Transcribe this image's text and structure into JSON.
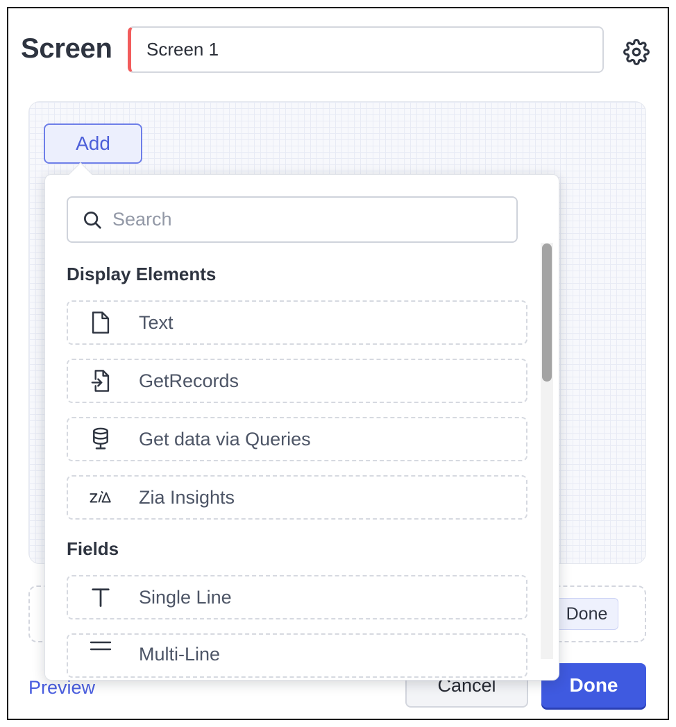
{
  "header": {
    "title": "Screen",
    "name_value": "Screen 1",
    "settings_icon": "gear-icon"
  },
  "canvas": {
    "add_label": "Add",
    "inner_done_label": "Done"
  },
  "popup": {
    "search_placeholder": "Search",
    "search_icon": "search-icon",
    "sections": [
      {
        "title": "Display Elements",
        "items": [
          {
            "label": "Text",
            "icon": "file-icon"
          },
          {
            "label": "GetRecords",
            "icon": "file-import-icon"
          },
          {
            "label": "Get data via Queries",
            "icon": "database-icon"
          },
          {
            "label": "Zia Insights",
            "icon": "zia-icon"
          }
        ]
      },
      {
        "title": "Fields",
        "items": [
          {
            "label": "Single Line",
            "icon": "text-t-icon"
          },
          {
            "label": "Multi-Line",
            "icon": "lines-icon"
          }
        ]
      }
    ]
  },
  "footer": {
    "preview_label": "Preview",
    "cancel_label": "Cancel",
    "done_label": "Done"
  },
  "colors": {
    "accent": "#3f5ae0",
    "required_marker": "#f25c5c"
  }
}
